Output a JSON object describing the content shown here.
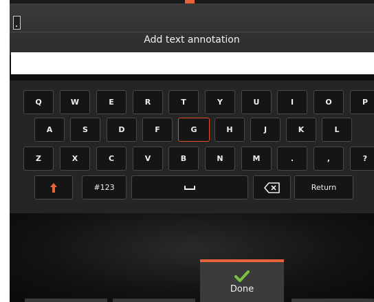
{
  "title": "Add text annotation",
  "input": {
    "value": "",
    "placeholder": ""
  },
  "keyboard": {
    "row1": [
      "Q",
      "W",
      "E",
      "R",
      "T",
      "Y",
      "U",
      "I",
      "O",
      "P"
    ],
    "row2": [
      "A",
      "S",
      "D",
      "F",
      "G",
      "H",
      "J",
      "K",
      "L"
    ],
    "row3": [
      "Z",
      "X",
      "C",
      "V",
      "B",
      "N",
      "M",
      ".",
      ",",
      "?"
    ],
    "selected_key": "G",
    "symbols_label": "#123",
    "return_label": "Return",
    "shift_icon": "shift-arrow-icon",
    "space_icon": "space-bar-icon",
    "backspace_icon": "backspace-icon"
  },
  "done": {
    "label": "Done",
    "icon": "checkmark-icon"
  },
  "colors": {
    "accent": "#e8643a",
    "selection": "#e2502d",
    "check": "#7cc242"
  }
}
